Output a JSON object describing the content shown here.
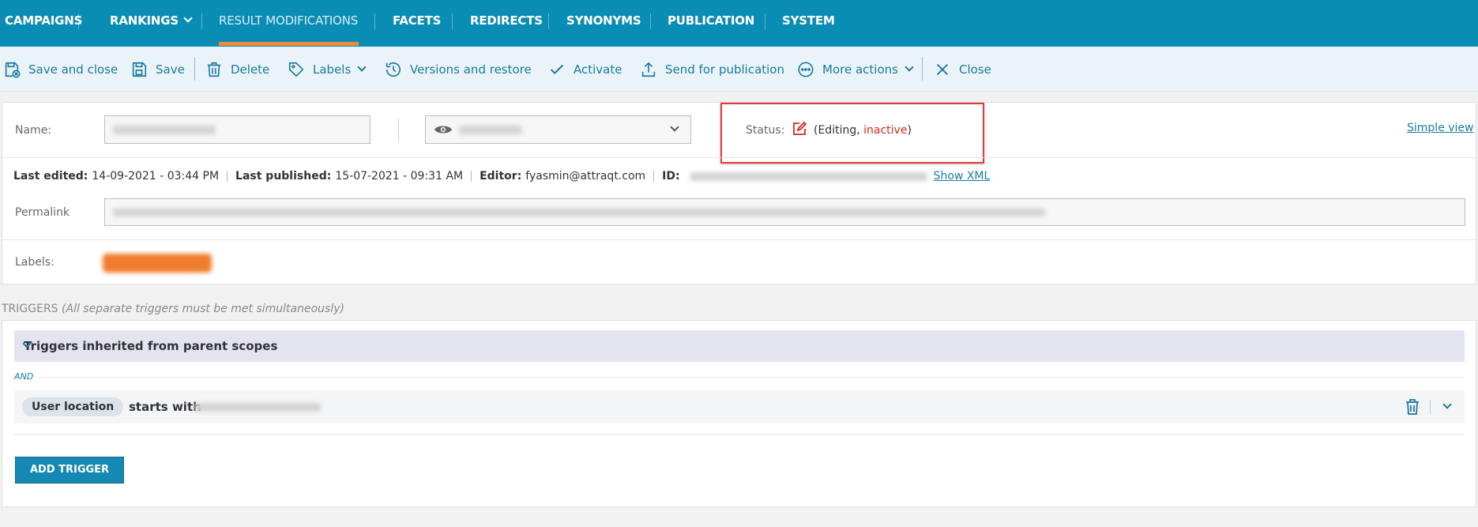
{
  "nav": {
    "items": [
      {
        "label": "CAMPAIGNS"
      },
      {
        "label": "RANKINGS"
      },
      {
        "label": "RESULT MODIFICATIONS"
      },
      {
        "label": "FACETS"
      },
      {
        "label": "REDIRECTS"
      },
      {
        "label": "SYNONYMS"
      },
      {
        "label": "PUBLICATION"
      },
      {
        "label": "SYSTEM"
      }
    ],
    "active": "RESULT MODIFICATIONS",
    "accent_color": "#f08a3c",
    "background": "#0a8db4"
  },
  "toolbar": {
    "save_and_close": "Save and close",
    "save": "Save",
    "delete": "Delete",
    "labels": "Labels",
    "versions": "Versions and restore",
    "activate": "Activate",
    "send": "Send for publication",
    "more": "More actions",
    "close": "Close"
  },
  "form": {
    "name_label": "Name:",
    "status_label": "Status:",
    "status_open": "(Editing, ",
    "status_state": "inactive",
    "status_close": ")",
    "status_state_color": "#d9261c",
    "simple_view": "Simple view",
    "last_edited_label": "Last edited:",
    "last_edited": "14-09-2021 - 03:44 PM",
    "last_published_label": "Last published:",
    "last_published": "15-07-2021 - 09:31 AM",
    "editor_label": "Editor:",
    "editor": "fyasmin@attraqt.com",
    "id_label": "ID:",
    "show_xml": "Show XML",
    "permalink_label": "Permalink",
    "labels_label": "Labels:"
  },
  "triggers": {
    "title": "TRIGGERS",
    "note": "(All separate triggers must be met simultaneously)",
    "inherited": "Triggers inherited from parent scopes",
    "and": "AND",
    "condition_field": "User location",
    "condition_op": "starts with",
    "add_button": "ADD TRIGGER"
  }
}
